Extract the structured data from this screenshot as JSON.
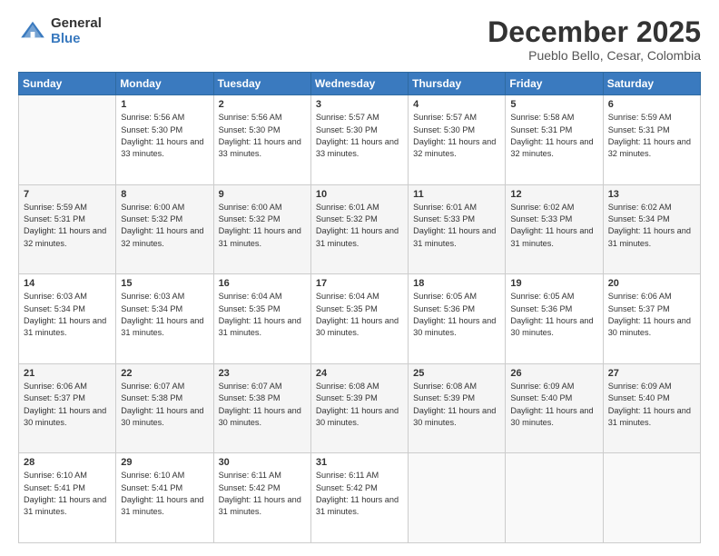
{
  "logo": {
    "general": "General",
    "blue": "Blue"
  },
  "header": {
    "month": "December 2025",
    "location": "Pueblo Bello, Cesar, Colombia"
  },
  "weekdays": [
    "Sunday",
    "Monday",
    "Tuesday",
    "Wednesday",
    "Thursday",
    "Friday",
    "Saturday"
  ],
  "weeks": [
    [
      {
        "day": "",
        "sunrise": "",
        "sunset": "",
        "daylight": ""
      },
      {
        "day": "1",
        "sunrise": "Sunrise: 5:56 AM",
        "sunset": "Sunset: 5:30 PM",
        "daylight": "Daylight: 11 hours and 33 minutes."
      },
      {
        "day": "2",
        "sunrise": "Sunrise: 5:56 AM",
        "sunset": "Sunset: 5:30 PM",
        "daylight": "Daylight: 11 hours and 33 minutes."
      },
      {
        "day": "3",
        "sunrise": "Sunrise: 5:57 AM",
        "sunset": "Sunset: 5:30 PM",
        "daylight": "Daylight: 11 hours and 33 minutes."
      },
      {
        "day": "4",
        "sunrise": "Sunrise: 5:57 AM",
        "sunset": "Sunset: 5:30 PM",
        "daylight": "Daylight: 11 hours and 32 minutes."
      },
      {
        "day": "5",
        "sunrise": "Sunrise: 5:58 AM",
        "sunset": "Sunset: 5:31 PM",
        "daylight": "Daylight: 11 hours and 32 minutes."
      },
      {
        "day": "6",
        "sunrise": "Sunrise: 5:59 AM",
        "sunset": "Sunset: 5:31 PM",
        "daylight": "Daylight: 11 hours and 32 minutes."
      }
    ],
    [
      {
        "day": "7",
        "sunrise": "Sunrise: 5:59 AM",
        "sunset": "Sunset: 5:31 PM",
        "daylight": "Daylight: 11 hours and 32 minutes."
      },
      {
        "day": "8",
        "sunrise": "Sunrise: 6:00 AM",
        "sunset": "Sunset: 5:32 PM",
        "daylight": "Daylight: 11 hours and 32 minutes."
      },
      {
        "day": "9",
        "sunrise": "Sunrise: 6:00 AM",
        "sunset": "Sunset: 5:32 PM",
        "daylight": "Daylight: 11 hours and 31 minutes."
      },
      {
        "day": "10",
        "sunrise": "Sunrise: 6:01 AM",
        "sunset": "Sunset: 5:32 PM",
        "daylight": "Daylight: 11 hours and 31 minutes."
      },
      {
        "day": "11",
        "sunrise": "Sunrise: 6:01 AM",
        "sunset": "Sunset: 5:33 PM",
        "daylight": "Daylight: 11 hours and 31 minutes."
      },
      {
        "day": "12",
        "sunrise": "Sunrise: 6:02 AM",
        "sunset": "Sunset: 5:33 PM",
        "daylight": "Daylight: 11 hours and 31 minutes."
      },
      {
        "day": "13",
        "sunrise": "Sunrise: 6:02 AM",
        "sunset": "Sunset: 5:34 PM",
        "daylight": "Daylight: 11 hours and 31 minutes."
      }
    ],
    [
      {
        "day": "14",
        "sunrise": "Sunrise: 6:03 AM",
        "sunset": "Sunset: 5:34 PM",
        "daylight": "Daylight: 11 hours and 31 minutes."
      },
      {
        "day": "15",
        "sunrise": "Sunrise: 6:03 AM",
        "sunset": "Sunset: 5:34 PM",
        "daylight": "Daylight: 11 hours and 31 minutes."
      },
      {
        "day": "16",
        "sunrise": "Sunrise: 6:04 AM",
        "sunset": "Sunset: 5:35 PM",
        "daylight": "Daylight: 11 hours and 31 minutes."
      },
      {
        "day": "17",
        "sunrise": "Sunrise: 6:04 AM",
        "sunset": "Sunset: 5:35 PM",
        "daylight": "Daylight: 11 hours and 30 minutes."
      },
      {
        "day": "18",
        "sunrise": "Sunrise: 6:05 AM",
        "sunset": "Sunset: 5:36 PM",
        "daylight": "Daylight: 11 hours and 30 minutes."
      },
      {
        "day": "19",
        "sunrise": "Sunrise: 6:05 AM",
        "sunset": "Sunset: 5:36 PM",
        "daylight": "Daylight: 11 hours and 30 minutes."
      },
      {
        "day": "20",
        "sunrise": "Sunrise: 6:06 AM",
        "sunset": "Sunset: 5:37 PM",
        "daylight": "Daylight: 11 hours and 30 minutes."
      }
    ],
    [
      {
        "day": "21",
        "sunrise": "Sunrise: 6:06 AM",
        "sunset": "Sunset: 5:37 PM",
        "daylight": "Daylight: 11 hours and 30 minutes."
      },
      {
        "day": "22",
        "sunrise": "Sunrise: 6:07 AM",
        "sunset": "Sunset: 5:38 PM",
        "daylight": "Daylight: 11 hours and 30 minutes."
      },
      {
        "day": "23",
        "sunrise": "Sunrise: 6:07 AM",
        "sunset": "Sunset: 5:38 PM",
        "daylight": "Daylight: 11 hours and 30 minutes."
      },
      {
        "day": "24",
        "sunrise": "Sunrise: 6:08 AM",
        "sunset": "Sunset: 5:39 PM",
        "daylight": "Daylight: 11 hours and 30 minutes."
      },
      {
        "day": "25",
        "sunrise": "Sunrise: 6:08 AM",
        "sunset": "Sunset: 5:39 PM",
        "daylight": "Daylight: 11 hours and 30 minutes."
      },
      {
        "day": "26",
        "sunrise": "Sunrise: 6:09 AM",
        "sunset": "Sunset: 5:40 PM",
        "daylight": "Daylight: 11 hours and 30 minutes."
      },
      {
        "day": "27",
        "sunrise": "Sunrise: 6:09 AM",
        "sunset": "Sunset: 5:40 PM",
        "daylight": "Daylight: 11 hours and 31 minutes."
      }
    ],
    [
      {
        "day": "28",
        "sunrise": "Sunrise: 6:10 AM",
        "sunset": "Sunset: 5:41 PM",
        "daylight": "Daylight: 11 hours and 31 minutes."
      },
      {
        "day": "29",
        "sunrise": "Sunrise: 6:10 AM",
        "sunset": "Sunset: 5:41 PM",
        "daylight": "Daylight: 11 hours and 31 minutes."
      },
      {
        "day": "30",
        "sunrise": "Sunrise: 6:11 AM",
        "sunset": "Sunset: 5:42 PM",
        "daylight": "Daylight: 11 hours and 31 minutes."
      },
      {
        "day": "31",
        "sunrise": "Sunrise: 6:11 AM",
        "sunset": "Sunset: 5:42 PM",
        "daylight": "Daylight: 11 hours and 31 minutes."
      },
      {
        "day": "",
        "sunrise": "",
        "sunset": "",
        "daylight": ""
      },
      {
        "day": "",
        "sunrise": "",
        "sunset": "",
        "daylight": ""
      },
      {
        "day": "",
        "sunrise": "",
        "sunset": "",
        "daylight": ""
      }
    ]
  ]
}
